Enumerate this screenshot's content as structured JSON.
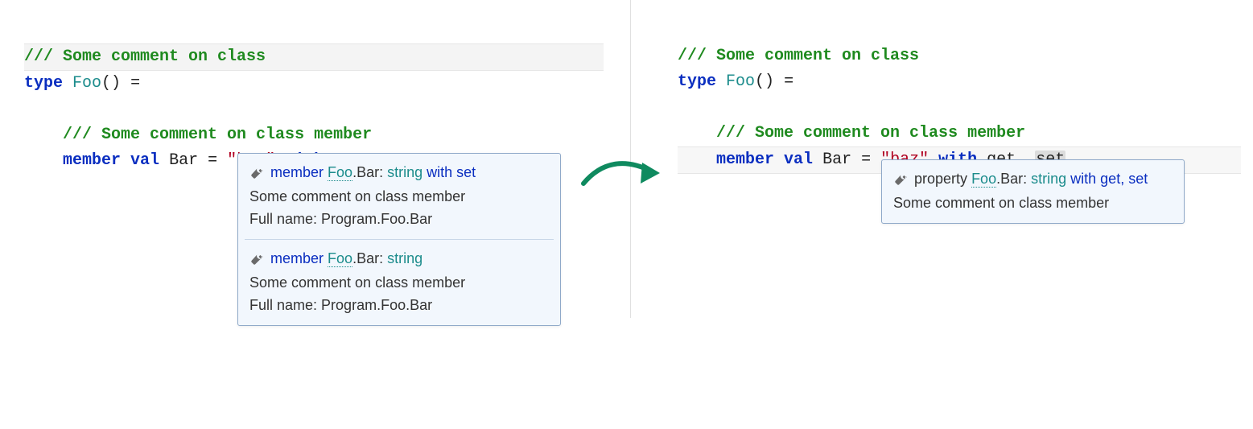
{
  "code": {
    "doc_class": "/// Some comment on class",
    "type_kw": "type",
    "type_name": "Foo",
    "type_parens": "()",
    "eq": " = ",
    "doc_member": "/// Some comment on class member",
    "member_kw": "member",
    "val_kw": "val",
    "ident": "Bar",
    "assign": " = ",
    "str_lit": "\"baz\"",
    "with_kw": "with",
    "get": "get",
    "comma": ", ",
    "set": "set"
  },
  "tooltip_left": {
    "sections": [
      {
        "sig": {
          "kw": "member",
          "type": "Foo",
          "dot": ".",
          "member": "Bar",
          "colon": ": ",
          "ret": "string",
          "tail": " with set"
        },
        "desc": "Some comment on class member",
        "full_label": "Full name: ",
        "full_value": "Program.Foo.Bar"
      },
      {
        "sig": {
          "kw": "member",
          "type": "Foo",
          "dot": ".",
          "member": "Bar",
          "colon": ": ",
          "ret": "string",
          "tail": ""
        },
        "desc": "Some comment on class member",
        "full_label": "Full name: ",
        "full_value": "Program.Foo.Bar"
      }
    ]
  },
  "tooltip_right": {
    "sig": {
      "kw": "property",
      "type": "Foo",
      "dot": ".",
      "member": "Bar",
      "colon": ": ",
      "ret": "string",
      "tail": " with get, set"
    },
    "desc": "Some comment on class member"
  },
  "icons": {
    "wrench": "wrench-icon"
  },
  "colors": {
    "keyword": "#0a2ec0",
    "type": "#1c8c8c",
    "doc": "#1f8a1f",
    "string": "#b00020",
    "tooltip_bg": "#f2f7fd",
    "tooltip_border": "#8fa9c9",
    "arrow": "#0f8a5f"
  }
}
